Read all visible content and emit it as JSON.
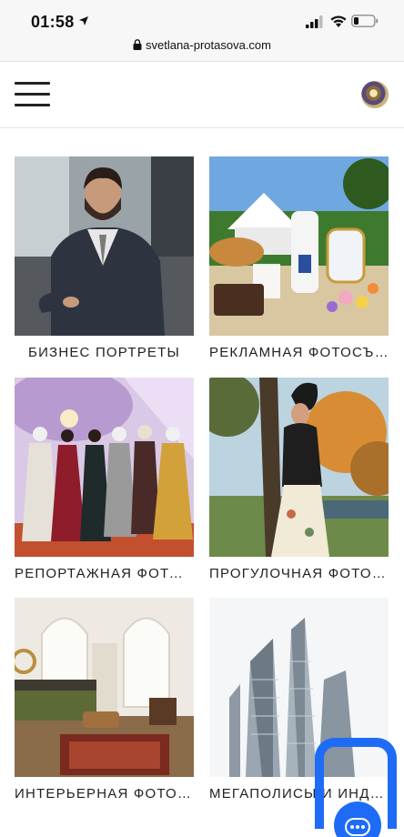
{
  "status_bar": {
    "time": "01:58",
    "url": "svetlana-protasova.com"
  },
  "header": {
    "menu_icon": "hamburger-menu-icon",
    "logo_icon": "site-logo"
  },
  "gallery": [
    {
      "caption": "БИЗНЕС ПОРТРЕТЫ",
      "image": "business-portrait-photo"
    },
    {
      "caption": "РЕКЛАМНАЯ ФОТОСЪЕ...",
      "image": "advertising-photo"
    },
    {
      "caption": "РЕПОРТАЖНАЯ ФОТОС...",
      "image": "reportage-photo"
    },
    {
      "caption": "ПРОГУЛОЧНАЯ ФОТОС...",
      "image": "walk-photo"
    },
    {
      "caption": "ИНТЕРЬЕРНАЯ ФОТОСЪ...",
      "image": "interior-photo"
    },
    {
      "caption": "МЕГАПОЛИСЫ И ИНДАСТ...",
      "image": "megapolis-photo"
    }
  ],
  "chat_widget": {
    "icon": "chat-bubble-icon",
    "accent": "#1e6cf6"
  }
}
